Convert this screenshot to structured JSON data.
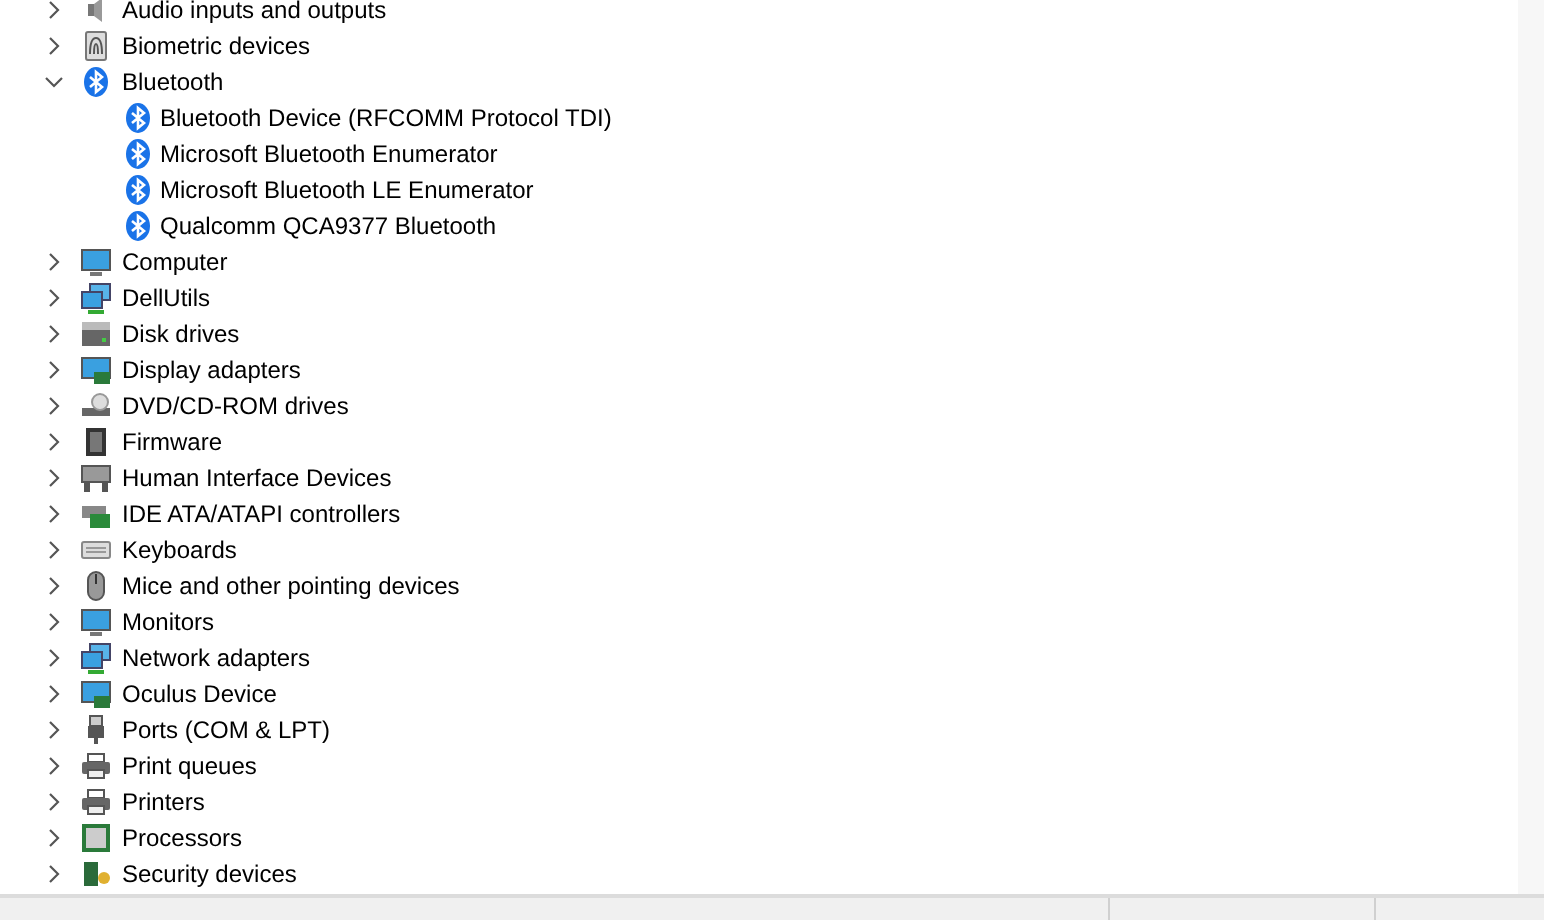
{
  "tree": [
    {
      "label": "Audio inputs and outputs",
      "kind": "audio",
      "expanded": false
    },
    {
      "label": "Biometric devices",
      "kind": "biometric",
      "expanded": false
    },
    {
      "label": "Bluetooth",
      "kind": "bluetooth",
      "expanded": true,
      "children": [
        {
          "label": "Bluetooth Device (RFCOMM Protocol TDI)",
          "kind": "bluetooth"
        },
        {
          "label": "Microsoft Bluetooth Enumerator",
          "kind": "bluetooth"
        },
        {
          "label": "Microsoft Bluetooth LE Enumerator",
          "kind": "bluetooth"
        },
        {
          "label": "Qualcomm QCA9377 Bluetooth",
          "kind": "bluetooth"
        }
      ]
    },
    {
      "label": "Computer",
      "kind": "monitor",
      "expanded": false
    },
    {
      "label": "DellUtils",
      "kind": "network",
      "expanded": false
    },
    {
      "label": "Disk drives",
      "kind": "disk",
      "expanded": false
    },
    {
      "label": "Display adapters",
      "kind": "display",
      "expanded": false
    },
    {
      "label": "DVD/CD-ROM drives",
      "kind": "dvd",
      "expanded": false
    },
    {
      "label": "Firmware",
      "kind": "chip",
      "expanded": false
    },
    {
      "label": "Human Interface Devices",
      "kind": "hid",
      "expanded": false
    },
    {
      "label": "IDE ATA/ATAPI controllers",
      "kind": "controller",
      "expanded": false
    },
    {
      "label": "Keyboards",
      "kind": "keyboard",
      "expanded": false
    },
    {
      "label": "Mice and other pointing devices",
      "kind": "mouse",
      "expanded": false
    },
    {
      "label": "Monitors",
      "kind": "monitor",
      "expanded": false
    },
    {
      "label": "Network adapters",
      "kind": "network",
      "expanded": false
    },
    {
      "label": "Oculus Device",
      "kind": "display",
      "expanded": false
    },
    {
      "label": "Ports (COM & LPT)",
      "kind": "port",
      "expanded": false
    },
    {
      "label": "Print queues",
      "kind": "printer",
      "expanded": false
    },
    {
      "label": "Printers",
      "kind": "printer",
      "expanded": false
    },
    {
      "label": "Processors",
      "kind": "processor",
      "expanded": false
    },
    {
      "label": "Security devices",
      "kind": "security",
      "expanded": false
    }
  ]
}
